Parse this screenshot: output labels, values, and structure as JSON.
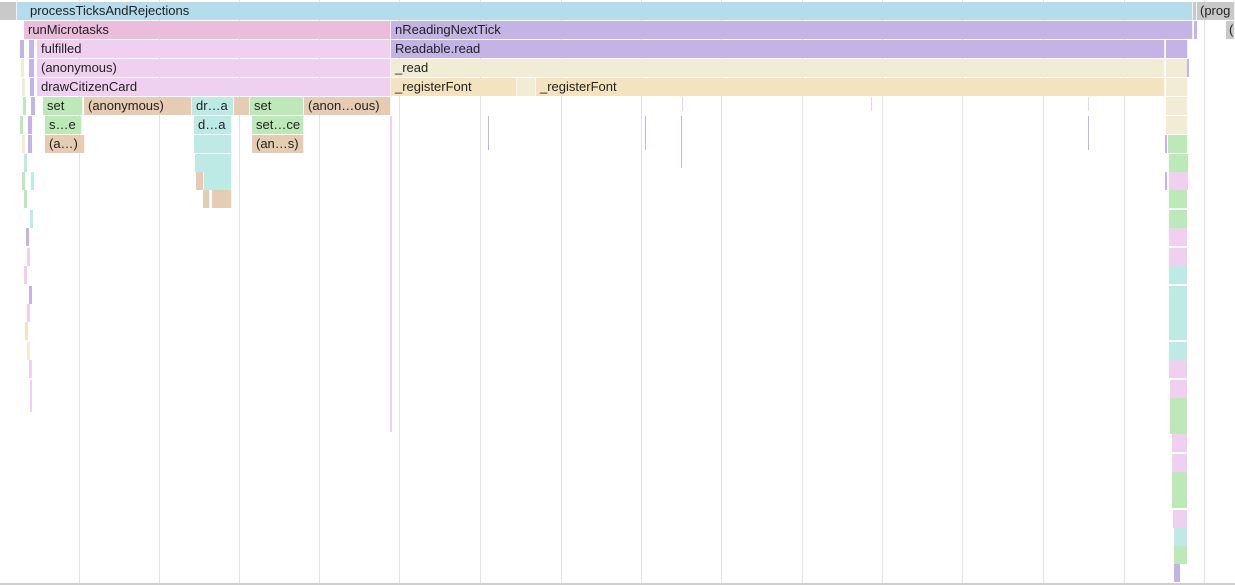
{
  "labels": {
    "process_ticks": "processTicksAndRejections",
    "prog": "(prog",
    "prog_sub": "(",
    "run_microtasks": "runMicrotasks",
    "n_reading_next_tick": "nReadingNextTick",
    "fulfilled": "fulfilled",
    "readable_read": "Readable.read",
    "anonymous": "(anonymous)",
    "read": "_read",
    "draw_citizen_card": "drawCitizenCard",
    "register_font_1": "_registerFont",
    "register_font_2": "_registerFont",
    "set_1": "set",
    "anonymous_2": "(anonymous)",
    "dr_a": "dr…a",
    "set_2": "set",
    "anon_ous": "(anon…ous)",
    "s_e": "s…e",
    "d_a": "d…a",
    "set_ce": "set…ce",
    "a_paren": "(a…)",
    "an_s": "(an…s)"
  },
  "colors": {
    "gray": "#c9c9c9",
    "blue": "#b5dcea",
    "pink": "#ecbcdc",
    "lavender": "#f0d0f0",
    "purple": "#c4b4e6",
    "cream": "#f2ecd6",
    "tan": "#f3e4bf",
    "green": "#bde8b8",
    "brown": "#e6ccb2",
    "teal": "#bdeae4"
  }
}
